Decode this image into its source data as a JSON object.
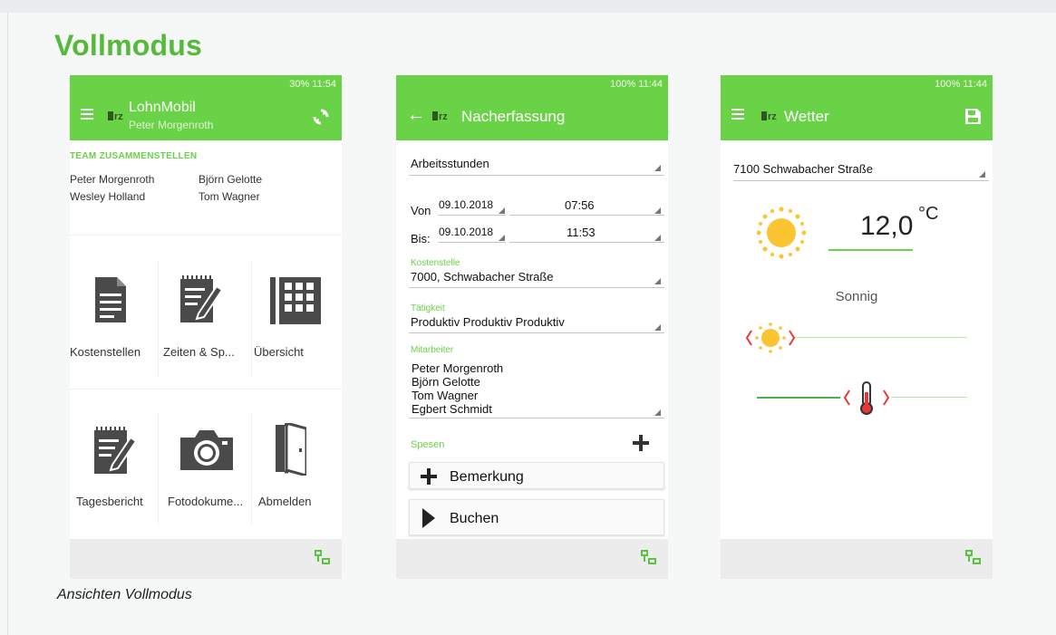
{
  "heading": "Vollmodus",
  "caption": "Ansichten Vollmodus",
  "colors": {
    "brand_green": "#6ad246",
    "heading_green": "#55b93a"
  },
  "phone1": {
    "status": "30% 11:54",
    "title": "LohnMobil",
    "subtitle": "Peter Morgenroth",
    "team_heading": "TEAM ZUSAMMENSTELLEN",
    "team": [
      "Peter Morgenroth",
      "Björn Gelotte",
      "Wesley Holland",
      "Tom Wagner"
    ],
    "tiles": [
      {
        "label": "Kostenstellen",
        "icon": "document-icon"
      },
      {
        "label": "Zeiten & Sp...",
        "icon": "notepad-pencil-icon"
      },
      {
        "label": "Übersicht",
        "icon": "grid-table-icon"
      },
      {
        "label": "Tagesbericht",
        "icon": "notepad-pencil-icon"
      },
      {
        "label": "Fotodokume...",
        "icon": "camera-icon"
      },
      {
        "label": "Abmelden",
        "icon": "door-exit-icon"
      }
    ]
  },
  "phone2": {
    "status": "100% 11:44",
    "title": "Nacherfassung",
    "type_value": "Arbeitsstunden",
    "von_label": "Von",
    "von_date": "09.10.2018",
    "von_time": "07:56",
    "bis_label": "Bis:",
    "bis_date": "09.10.2018",
    "bis_time": "11:53",
    "kostenstelle_label": "Kostenstelle",
    "kostenstelle_value": "7000, Schwabacher Straße",
    "taetigkeit_label": "Tätigkeit",
    "taetigkeit_value": "Produktiv Produktiv Produktiv",
    "mitarbeiter_label": "Mitarbeiter",
    "mitarbeiter": [
      "Peter Morgenroth",
      "Björn Gelotte",
      "Tom Wagner",
      "Egbert Schmidt"
    ],
    "spesen_label": "Spesen",
    "bemerkung_label": "Bemerkung",
    "buchen_label": "Buchen"
  },
  "phone3": {
    "status": "100% 11:44",
    "title": "Wetter",
    "location": "7100 Schwabacher Straße",
    "temperature": "12,0",
    "unit": "°C",
    "description": "Sonnig"
  }
}
